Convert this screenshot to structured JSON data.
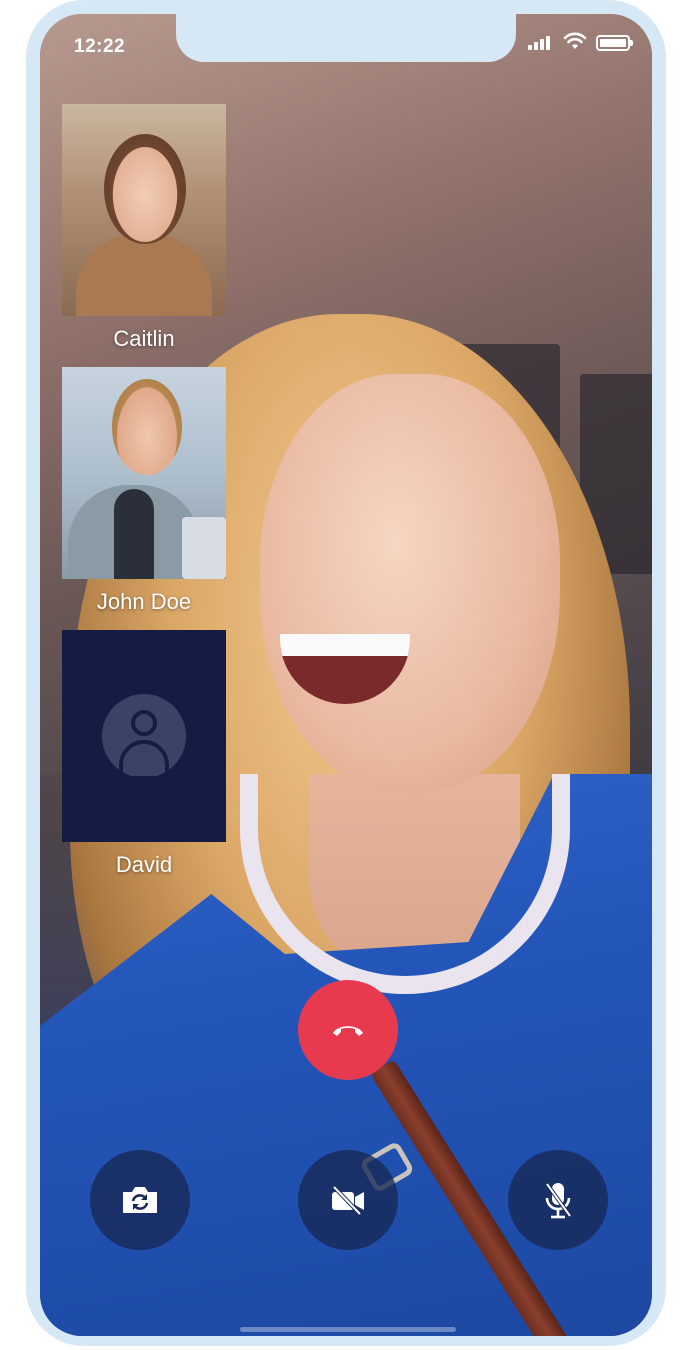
{
  "status_bar": {
    "time": "12:22",
    "icons": [
      "cellular-signal-icon",
      "wifi-icon",
      "battery-icon"
    ]
  },
  "participants": [
    {
      "name": "Caitlin",
      "video": "on"
    },
    {
      "name": "John Doe",
      "video": "on"
    },
    {
      "name": "David",
      "video": "off"
    }
  ],
  "controls": {
    "end_call": {
      "icon": "phone-hangup-icon",
      "color": "#e83a4f"
    },
    "flip_camera": {
      "icon": "camera-flip-icon"
    },
    "video_toggle": {
      "icon": "video-off-icon"
    },
    "mic_toggle": {
      "icon": "mic-off-icon"
    }
  },
  "colors": {
    "device_frame": "#d6e7f5",
    "control_bg": "#172854",
    "avatar_tile_bg": "#141c44",
    "end_call": "#e83a4f"
  }
}
